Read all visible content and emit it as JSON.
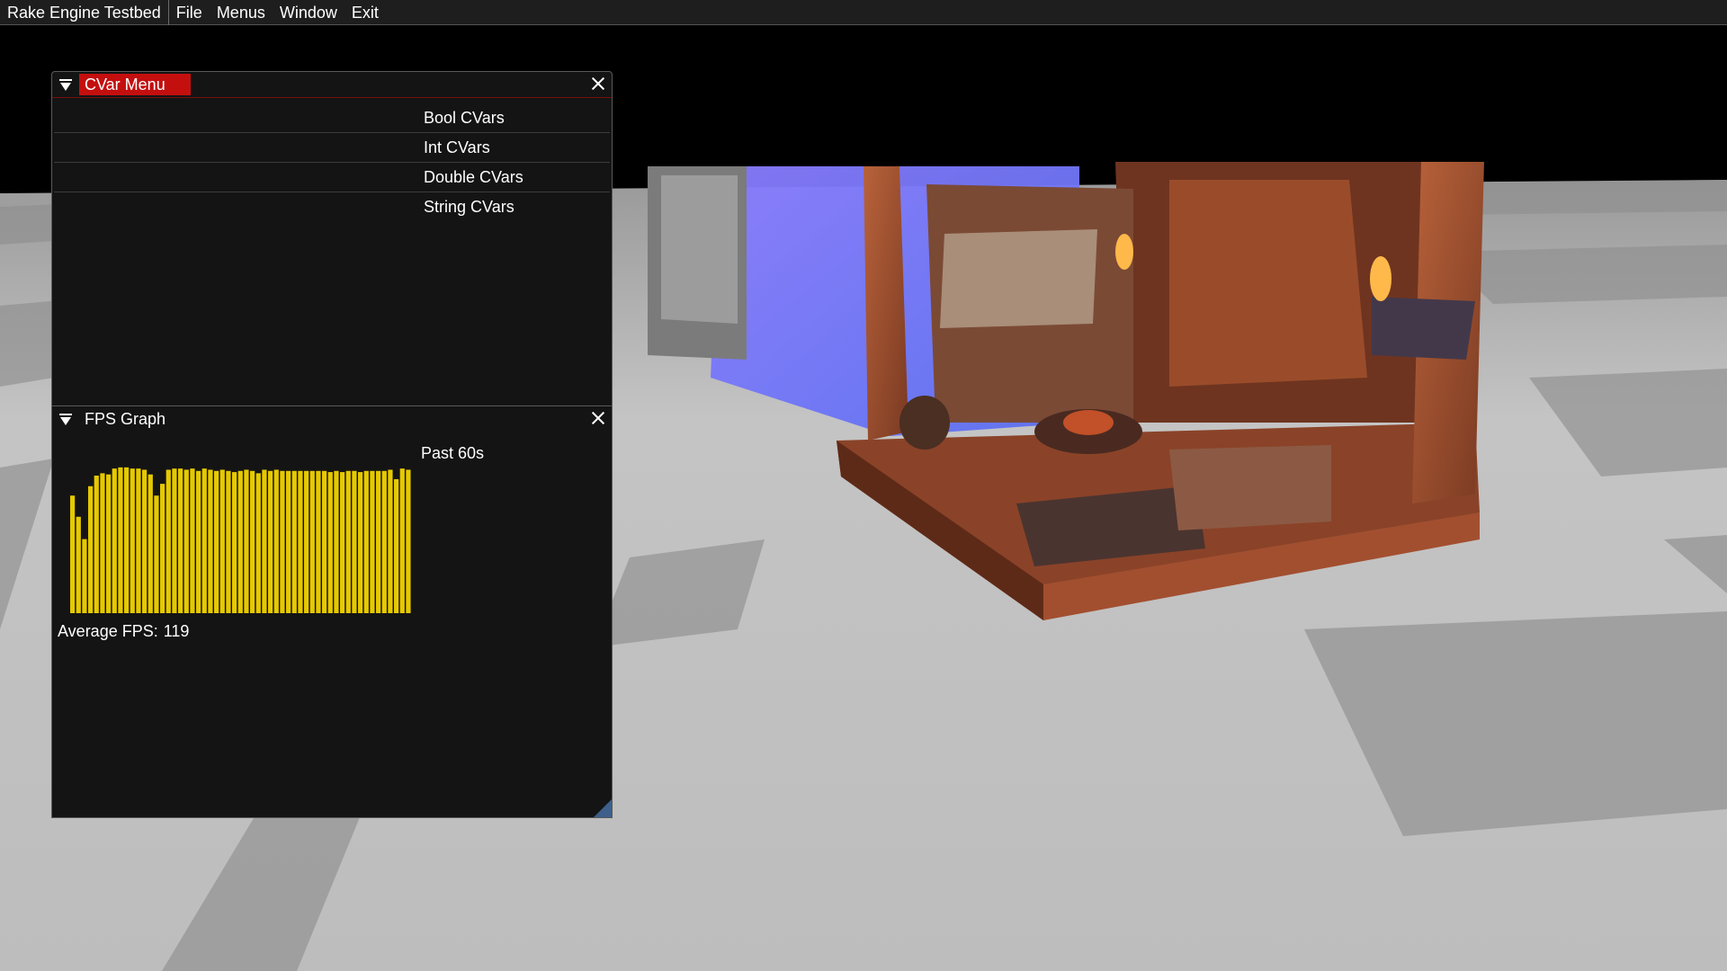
{
  "menubar": {
    "app_title": "Rake Engine Testbed",
    "items": [
      "File",
      "Menus",
      "Window",
      "Exit"
    ]
  },
  "cvar_window": {
    "title": "CVar Menu",
    "items": [
      "Bool CVars",
      "Int CVars",
      "Double CVars",
      "String CVars"
    ]
  },
  "fps_window": {
    "title": "FPS Graph",
    "overlay": "Past 60s",
    "average_label": "Average FPS:",
    "average_value": "119"
  },
  "chart_data": {
    "type": "bar",
    "title": "",
    "overlay_text": "Past 60s",
    "ylim": [
      0,
      130
    ],
    "values": [
      100,
      82,
      63,
      108,
      117,
      119,
      118,
      123,
      124,
      124,
      123,
      123,
      122,
      118,
      100,
      110,
      122,
      123,
      123,
      122,
      123,
      121,
      123,
      122,
      121,
      122,
      121,
      120,
      121,
      122,
      121,
      119,
      122,
      121,
      122,
      121,
      121,
      121,
      121,
      121,
      121,
      121,
      121,
      120,
      121,
      120,
      121,
      121,
      120,
      121,
      121,
      121,
      121,
      122,
      114,
      123,
      122
    ],
    "bar_color": "#e6c900"
  },
  "icons": {
    "collapse": "collapse-arrow-icon",
    "close": "close-icon"
  },
  "colors": {
    "title_active": "#c40f0f",
    "panel_bg": "#141414",
    "menubar_bg": "#1e1e1e",
    "floor_light": "#c8c8c8",
    "floor_dark": "#a4a4a4"
  }
}
